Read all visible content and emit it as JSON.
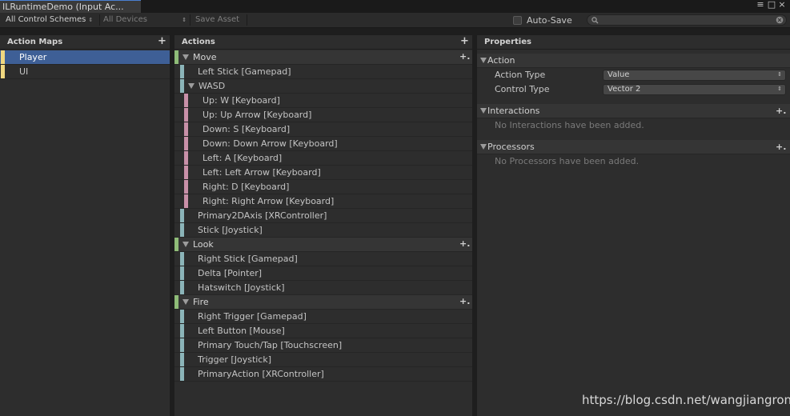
{
  "window": {
    "tab_title": "ILRuntimeDemo (Input Ac...",
    "menu_icon": "≡",
    "maximize_icon": "□",
    "close_icon": "×"
  },
  "toolbar": {
    "control_schemes": "All Control Schemes",
    "devices": "All Devices",
    "save_asset": "Save Asset",
    "auto_save": "Auto-Save",
    "updown_glyph": "⇕",
    "search_placeholder": ""
  },
  "action_maps": {
    "title": "Action Maps",
    "items": [
      {
        "label": "Player",
        "selected": true
      },
      {
        "label": "UI",
        "selected": false
      }
    ]
  },
  "actions": {
    "title": "Actions",
    "rows": [
      {
        "kind": "action",
        "label": "Move"
      },
      {
        "kind": "binding",
        "label": "Left Stick [Gamepad]"
      },
      {
        "kind": "composite",
        "label": "WASD"
      },
      {
        "kind": "part",
        "label": "Up: W [Keyboard]"
      },
      {
        "kind": "part",
        "label": "Up: Up Arrow [Keyboard]"
      },
      {
        "kind": "part",
        "label": "Down: S [Keyboard]"
      },
      {
        "kind": "part",
        "label": "Down: Down Arrow [Keyboard]"
      },
      {
        "kind": "part",
        "label": "Left: A [Keyboard]"
      },
      {
        "kind": "part",
        "label": "Left: Left Arrow [Keyboard]"
      },
      {
        "kind": "part",
        "label": "Right: D [Keyboard]"
      },
      {
        "kind": "part",
        "label": "Right: Right Arrow [Keyboard]"
      },
      {
        "kind": "binding",
        "label": "Primary2DAxis [XRController]"
      },
      {
        "kind": "binding",
        "label": "Stick [Joystick]"
      },
      {
        "kind": "action",
        "label": "Look"
      },
      {
        "kind": "binding",
        "label": "Right Stick [Gamepad]"
      },
      {
        "kind": "binding",
        "label": "Delta [Pointer]"
      },
      {
        "kind": "binding",
        "label": "Hatswitch [Joystick]"
      },
      {
        "kind": "action",
        "label": "Fire"
      },
      {
        "kind": "binding",
        "label": "Right Trigger [Gamepad]"
      },
      {
        "kind": "binding",
        "label": "Left Button [Mouse]"
      },
      {
        "kind": "binding",
        "label": "Primary Touch/Tap [Touchscreen]"
      },
      {
        "kind": "binding",
        "label": "Trigger [Joystick]"
      },
      {
        "kind": "binding",
        "label": "PrimaryAction [XRController]"
      }
    ]
  },
  "properties": {
    "title": "Properties",
    "action_section": "Action",
    "action_type_label": "Action Type",
    "action_type_value": "Value",
    "control_type_label": "Control Type",
    "control_type_value": "Vector 2",
    "interactions_section": "Interactions",
    "interactions_empty": "No Interactions have been added.",
    "processors_section": "Processors",
    "processors_empty": "No Processors have been added."
  },
  "icons": {
    "plus": "+",
    "plus_dropdown": "+.",
    "updown": "⇕"
  },
  "colors": {
    "selection": "#3e5f96",
    "action_map_bar": "#f0d880",
    "action_bar": "#8fbc78",
    "binding_bar": "#8bb4b8",
    "part_bar": "#c890a8"
  },
  "watermark": "https://blog.csdn.net/wangjiangrong"
}
